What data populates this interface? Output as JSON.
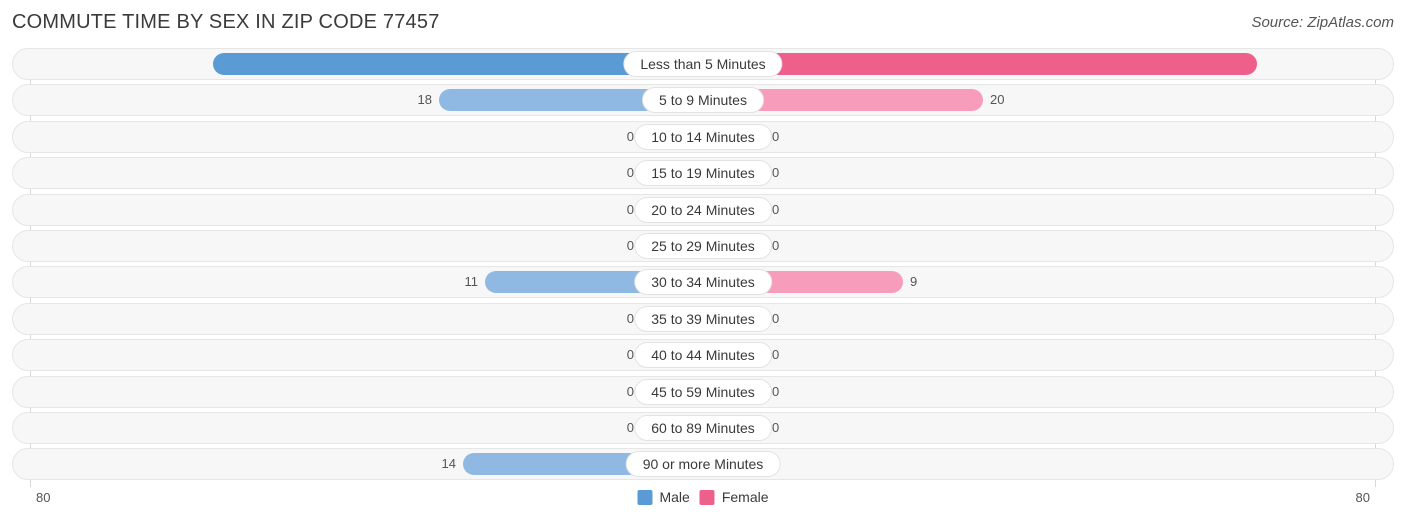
{
  "header": {
    "title": "COMMUTE TIME BY SEX IN ZIP CODE 77457",
    "source": "Source: ZipAtlas.com"
  },
  "legend": {
    "male_label": "Male",
    "female_label": "Female",
    "male_color": "#5b9bd5",
    "female_color": "#ef5f8b"
  },
  "axis": {
    "left_max": "80",
    "right_max": "80"
  },
  "colors": {
    "male_strong": "#5b9bd5",
    "male_light": "#8fb8e3",
    "female_strong": "#ef5f8b",
    "female_light": "#f79dbb",
    "track_fill": "#f7f7f7",
    "track_border": "#e6e6e6"
  },
  "chart_data": {
    "type": "bar",
    "title": "COMMUTE TIME BY SEX IN ZIP CODE 77457",
    "subtitle": "Source: ZipAtlas.com",
    "orientation": "horizontal-diverging",
    "xlabel": "",
    "ylabel": "",
    "xlim": [
      80,
      80
    ],
    "axis_max": 80,
    "grid": false,
    "legend_position": "bottom-center",
    "categories": [
      "Less than 5 Minutes",
      "5 to 9 Minutes",
      "10 to 14 Minutes",
      "15 to 19 Minutes",
      "20 to 24 Minutes",
      "25 to 29 Minutes",
      "30 to 34 Minutes",
      "35 to 39 Minutes",
      "40 to 44 Minutes",
      "45 to 59 Minutes",
      "60 to 89 Minutes",
      "90 or more Minutes"
    ],
    "series": [
      {
        "name": "Male",
        "values": [
          52,
          18,
          0,
          0,
          0,
          0,
          11,
          0,
          0,
          0,
          0,
          14
        ]
      },
      {
        "name": "Female",
        "values": [
          61,
          20,
          0,
          0,
          0,
          0,
          9,
          0,
          0,
          0,
          0,
          0
        ]
      }
    ]
  },
  "rows": [
    {
      "label": "Less than 5 Minutes",
      "male": "52",
      "female": "61",
      "male_w": 490,
      "female_w": 554,
      "male_in": true,
      "female_in": true,
      "male_strong": true,
      "female_strong": true
    },
    {
      "label": "5 to 9 Minutes",
      "male": "18",
      "female": "20",
      "male_w": 264,
      "female_w": 280,
      "male_in": false,
      "female_in": false,
      "male_strong": false,
      "female_strong": false
    },
    {
      "label": "10 to 14 Minutes",
      "male": "0",
      "female": "0",
      "male_w": 62,
      "female_w": 62,
      "male_in": false,
      "female_in": false,
      "male_strong": false,
      "female_strong": false
    },
    {
      "label": "15 to 19 Minutes",
      "male": "0",
      "female": "0",
      "male_w": 62,
      "female_w": 62,
      "male_in": false,
      "female_in": false,
      "male_strong": false,
      "female_strong": false
    },
    {
      "label": "20 to 24 Minutes",
      "male": "0",
      "female": "0",
      "male_w": 62,
      "female_w": 62,
      "male_in": false,
      "female_in": false,
      "male_strong": false,
      "female_strong": false
    },
    {
      "label": "25 to 29 Minutes",
      "male": "0",
      "female": "0",
      "male_w": 62,
      "female_w": 62,
      "male_in": false,
      "female_in": false,
      "male_strong": false,
      "female_strong": false
    },
    {
      "label": "30 to 34 Minutes",
      "male": "11",
      "female": "9",
      "male_w": 218,
      "female_w": 200,
      "male_in": false,
      "female_in": false,
      "male_strong": false,
      "female_strong": false
    },
    {
      "label": "35 to 39 Minutes",
      "male": "0",
      "female": "0",
      "male_w": 62,
      "female_w": 62,
      "male_in": false,
      "female_in": false,
      "male_strong": false,
      "female_strong": false
    },
    {
      "label": "40 to 44 Minutes",
      "male": "0",
      "female": "0",
      "male_w": 62,
      "female_w": 62,
      "male_in": false,
      "female_in": false,
      "male_strong": false,
      "female_strong": false
    },
    {
      "label": "45 to 59 Minutes",
      "male": "0",
      "female": "0",
      "male_w": 62,
      "female_w": 62,
      "male_in": false,
      "female_in": false,
      "male_strong": false,
      "female_strong": false
    },
    {
      "label": "60 to 89 Minutes",
      "male": "0",
      "female": "0",
      "male_w": 62,
      "female_w": 62,
      "male_in": false,
      "female_in": false,
      "male_strong": false,
      "female_strong": false
    },
    {
      "label": "90 or more Minutes",
      "male": "14",
      "female": "0",
      "male_w": 240,
      "female_w": 62,
      "male_in": false,
      "female_in": false,
      "male_strong": false,
      "female_strong": false
    }
  ]
}
